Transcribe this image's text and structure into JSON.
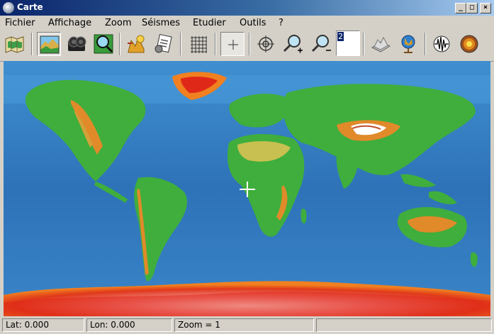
{
  "window": {
    "title": "Carte"
  },
  "menu": [
    "Fichier",
    "Affichage",
    "Zoom",
    "Séismes",
    "Etudier",
    "Outils",
    "?"
  ],
  "toolbar": {
    "tools": [
      {
        "name": "map-tool-icon",
        "pressed": false
      },
      {
        "name": "relief-map-icon",
        "pressed": true
      },
      {
        "name": "camera-icon",
        "pressed": false
      },
      {
        "name": "zoom-map-icon",
        "pressed": false
      },
      {
        "name": "earthquake-list-icon",
        "pressed": false
      },
      {
        "name": "document-list-icon",
        "pressed": false
      },
      {
        "name": "grid-icon",
        "pressed": false
      },
      {
        "name": "crosshair-cursor-icon",
        "pressed": true
      },
      {
        "name": "target-icon",
        "pressed": false
      },
      {
        "name": "zoom-in-icon",
        "pressed": false
      },
      {
        "name": "zoom-out-icon",
        "pressed": false
      },
      {
        "name": "terrain-3d-icon",
        "pressed": false
      },
      {
        "name": "globe-icon",
        "pressed": false
      },
      {
        "name": "seismogram-icon",
        "pressed": false
      },
      {
        "name": "earth-interior-icon",
        "pressed": false
      }
    ],
    "zoom_value": "2"
  },
  "status": {
    "lat": "Lat: 0.000",
    "lon": "Lon: 0.000",
    "zoom": "Zoom = 1"
  }
}
